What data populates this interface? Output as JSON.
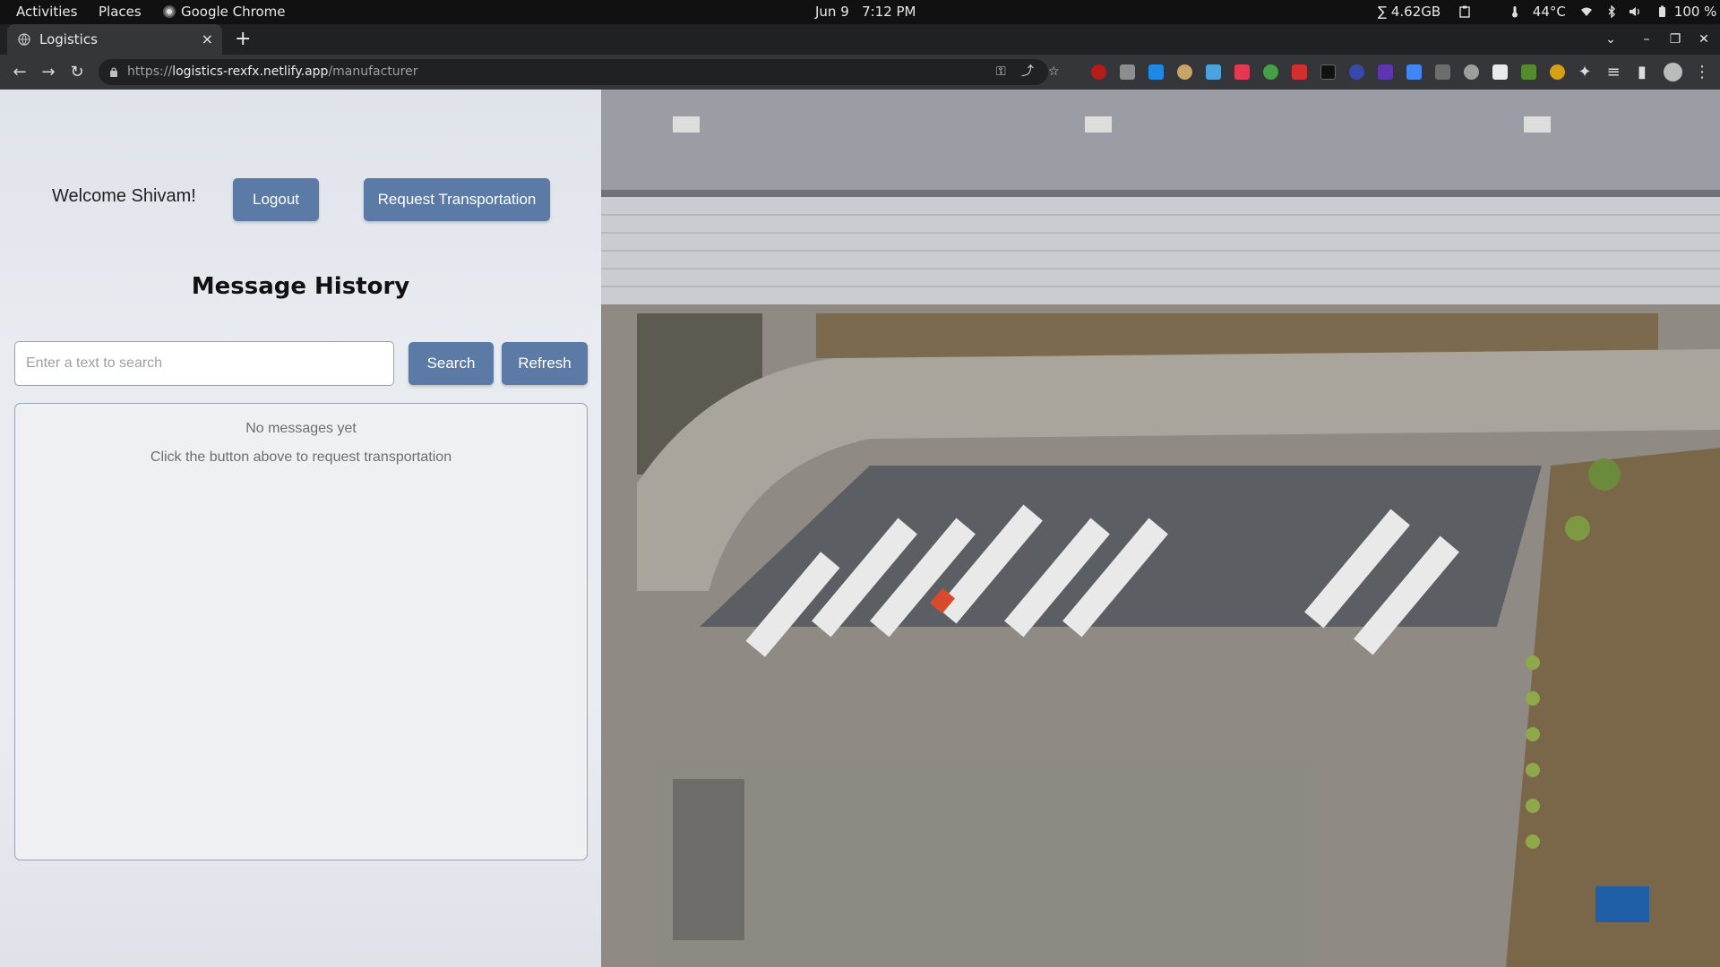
{
  "system_bar": {
    "activities": "Activities",
    "places": "Places",
    "app_name": "Google Chrome",
    "date": "Jun 9",
    "time": "7:12 PM",
    "memory": "∑ 4.62GB",
    "temperature": "44°C",
    "battery": "100 %"
  },
  "browser": {
    "tab_title": "Logistics",
    "tab_close": "×",
    "new_tab": "+",
    "url_scheme": "https://",
    "url_host": "logistics-rexfx.netlify.app",
    "url_path": "/manufacturer"
  },
  "header": {
    "welcome": "Welcome Shivam!",
    "logout_label": "Logout",
    "request_label": "Request Transportation"
  },
  "history": {
    "title": "Message History",
    "search_placeholder": "Enter a text to search",
    "search_value": "",
    "search_label": "Search",
    "refresh_label": "Refresh",
    "empty_title": "No messages yet",
    "empty_hint": "Click the button above to request transportation"
  },
  "colors": {
    "button": "#5c7aa6",
    "panel": "#e9ecf1",
    "chrome_dark": "#202124",
    "chrome_toolbar": "#35363a"
  }
}
